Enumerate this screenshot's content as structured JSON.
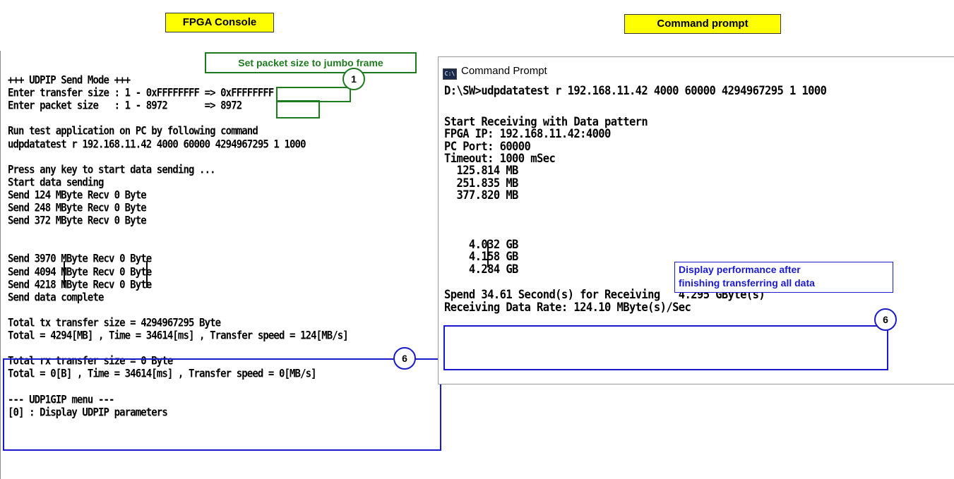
{
  "labels": {
    "fpga_console": "FPGA Console",
    "command_prompt": "Command prompt"
  },
  "fpga": {
    "callout_text": "Set packet size to jumbo frame",
    "step1": "1",
    "step6": "6",
    "lines": [
      "+++ UDPIP Send Mode +++",
      "Enter transfer size : 1 - 0xFFFFFFFF => 0xFFFFFFFF",
      "Enter packet size   : 1 - 8972       => 8972",
      "",
      "Run test application on PC by following command",
      "udpdatatest r 192.168.11.42 4000 60000 4294967295 1 1000",
      "",
      "Press any key to start data sending ...",
      "Start data sending",
      "Send 124 MByte Recv 0 Byte",
      "Send 248 MByte Recv 0 Byte",
      "Send 372 MByte Recv 0 Byte",
      "",
      "",
      "Send 3970 MByte Recv 0 Byte",
      "Send 4094 MByte Recv 0 Byte",
      "Send 4218 MByte Recv 0 Byte",
      "Send data complete",
      "",
      "Total tx transfer size = 4294967295 Byte",
      "Total = 4294[MB] , Time = 34614[ms] , Transfer speed = 124[MB/s]",
      "",
      "Total rx transfer size = 0 Byte",
      "Total = 0[B] , Time = 34614[ms] , Transfer speed = 0[MB/s]",
      "",
      "--- UDP1GIP menu ---",
      "[0] : Display UDPIP parameters"
    ]
  },
  "cmd": {
    "title": "Command Prompt",
    "icon": "cmd-window-icon",
    "icon_text": "C:\\",
    "step6": "6",
    "note_line1": "Display performance after",
    "note_line2": "finishing transferring all data",
    "lines": [
      "D:\\SW>udpdatatest r 192.168.11.42 4000 60000 4294967295 1 1000",
      "",
      "Start Receiving with Data pattern",
      "FPGA IP: 192.168.11.42:4000",
      "PC Port: 60000",
      "Timeout: 1000 mSec",
      "  125.814 MB",
      "  251.835 MB",
      "  377.820 MB",
      "",
      "",
      "",
      "    4.032 GB",
      "    4.158 GB",
      "    4.284 GB",
      "",
      "Spend 34.61 Second(s) for Receiving   4.295 GByte(s)",
      "Receiving Data Rate: 124.10 MByte(s)/Sec"
    ]
  },
  "colors": {
    "label_bg": "#ffff00",
    "callout_green": "#1f7a1f",
    "highlight_blue": "#1a1acc"
  }
}
